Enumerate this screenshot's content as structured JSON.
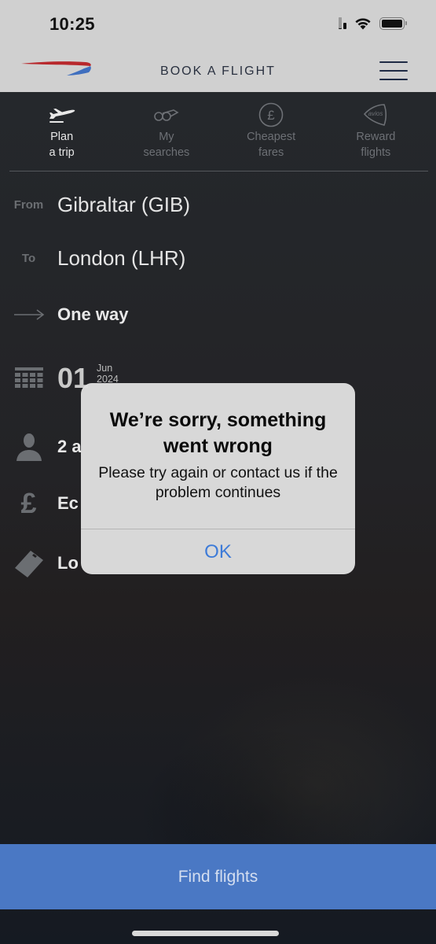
{
  "status_bar": {
    "time": "10:25",
    "signal_bars_active": 2,
    "signal_bars_total": 4,
    "wifi_icon": "wifi-icon",
    "battery_icon": "battery-icon"
  },
  "header": {
    "logo": "british-airways-speedmarque",
    "title": "BOOK A FLIGHT",
    "menu_icon": "hamburger-menu-icon"
  },
  "tabs": [
    {
      "label": "Plan\na trip",
      "icon": "airplane-icon",
      "active": true
    },
    {
      "label": "My\nsearches",
      "icon": "binoculars-icon",
      "active": false
    },
    {
      "label": "Cheapest\nfares",
      "icon": "pound-circle-icon",
      "active": false
    },
    {
      "label": "Reward\nflights",
      "icon": "avios-icon",
      "active": false
    }
  ],
  "avios_badge": "avios",
  "form": {
    "from": {
      "label": "From",
      "value": "Gibraltar (GIB)"
    },
    "to": {
      "label": "To",
      "value": "London (LHR)"
    },
    "trip_type": {
      "icon": "arrow-right-icon",
      "value": "One way"
    },
    "date": {
      "icon": "calendar-icon",
      "day": "01",
      "month": "Jun",
      "year": "2024"
    },
    "passengers": {
      "icon": "person-icon",
      "value": "2 a"
    },
    "cabin": {
      "icon": "pound-icon",
      "value": "Ec"
    },
    "fare": {
      "icon": "ticket-icon",
      "value": "Lo"
    }
  },
  "alert": {
    "title": "We’re sorry, something went wrong",
    "message": "Please try again or contact us if the problem continues",
    "ok_label": "OK"
  },
  "find_button": {
    "label": "Find flights"
  },
  "colors": {
    "header_bg": "#d0d0d0",
    "find_button_bg": "#4a78c4",
    "alert_action": "#3d7bd8",
    "ba_red": "#b8282c",
    "ba_blue": "#3f6fbf"
  }
}
